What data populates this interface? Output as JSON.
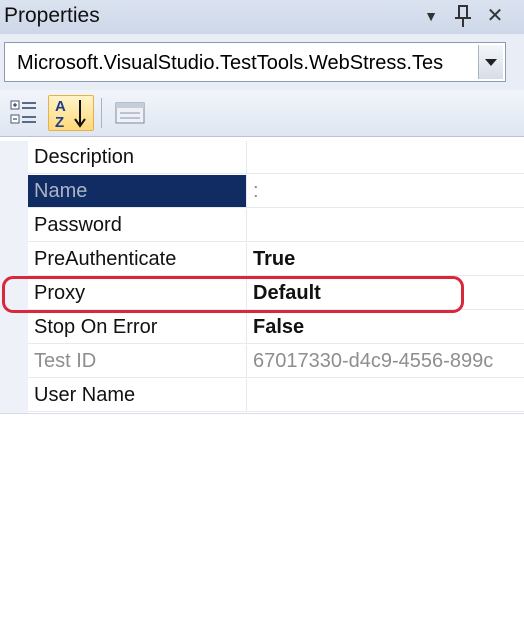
{
  "window": {
    "title": "Properties",
    "dropdown_glyph": "▼",
    "pin_glyph": "⊥",
    "close_glyph": "✕"
  },
  "object_selector": {
    "value": "Microsoft.VisualStudio.TestTools.WebStress.Tes"
  },
  "toolbar": {
    "buttons": [
      "categorized",
      "alphabetical",
      "property-pages"
    ],
    "active": "alphabetical",
    "alphabetical_top_letter": "A",
    "alphabetical_bottom_letter": "Z"
  },
  "properties": [
    {
      "name": "Description",
      "value": ""
    },
    {
      "name": "Name",
      "value": ":"
    },
    {
      "name": "Password",
      "value": ""
    },
    {
      "name": "PreAuthenticate",
      "value": "True"
    },
    {
      "name": "Proxy",
      "value": "Default"
    },
    {
      "name": "Stop On Error",
      "value": "False"
    },
    {
      "name": "Test ID",
      "value": "67017330-d4c9-4556-899c"
    },
    {
      "name": "User Name",
      "value": ""
    }
  ],
  "selected_property": "Name",
  "highlighted_property": "Proxy",
  "colors": {
    "selection": "#102c63",
    "highlight_outline": "#d9283c",
    "toolbar_active": "#ffd97a"
  }
}
